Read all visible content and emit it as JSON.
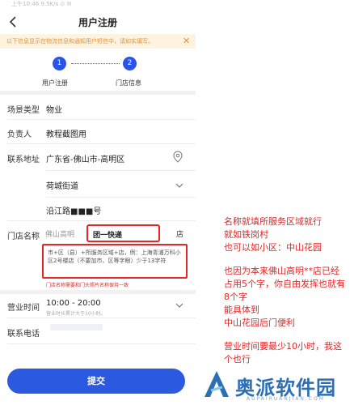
{
  "status_bar": {
    "text": "上午10:46 9.5K/s ⊙ ✉"
  },
  "nav": {
    "title": "用户注册"
  },
  "notice": {
    "text": "以下信息显示在物流信息和通知用户短信中，请如实填写。",
    "close": "✕"
  },
  "steps": [
    {
      "number": "1",
      "label": "用户注册"
    },
    {
      "number": "2",
      "label": "门店信息"
    }
  ],
  "form": {
    "venue_type": {
      "label": "场景类型",
      "value": "物业"
    },
    "contact": {
      "label": "负责人",
      "value": "教程截图用"
    },
    "address": {
      "label": "联系地址",
      "region": "广东省-佛山市-高明区",
      "street": "荷城街道",
      "detail": "沿江路■■■号"
    },
    "shop_name": {
      "label": "门店名称",
      "prefix": "佛山高明",
      "value": "团一快递",
      "suffix": "店",
      "hint": "市+区（县）+所服务区域+店，例：上海青浦万科小区2号楼店（不要加市、区等字眼）少于13字符",
      "warning": "门店名称需要和门头照片名称保持一致"
    },
    "hours": {
      "label": "营业时间",
      "value": "10:00 - 20:00",
      "sub": "营业时长累计大于10小时。"
    },
    "phone": {
      "label": "联系电话"
    }
  },
  "submit": {
    "label": "提交"
  },
  "annotations": [
    "名称就填所服务区域就行",
    "就如铁岗村",
    "也可以如小区：中山花园",
    "也因为本来佛山高明**店已经",
    "占用5个字，你自由发挥也就有",
    "8个字",
    "能具体到",
    "中山花园后门便利",
    "营业时间要最少10小时，我这",
    "个也行"
  ],
  "watermark": {
    "text": "奥派软件园",
    "sub": "AUPAIRUANJIAN.COM"
  },
  "colors": {
    "primary": "#2b5ae0",
    "annotation_red": "#e32626",
    "notice_bg": "#fdf3df",
    "notice_text": "#e2923a"
  }
}
